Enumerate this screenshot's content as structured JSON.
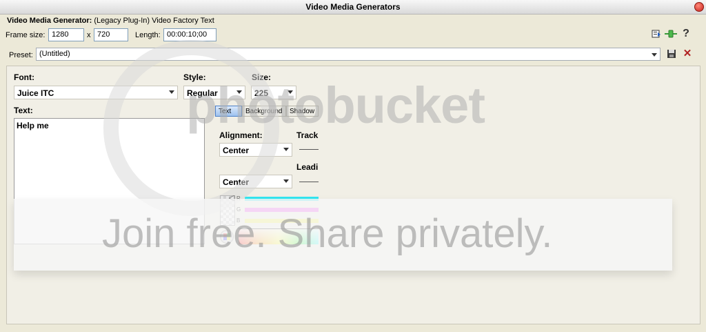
{
  "window": {
    "title": "Video Media Generators"
  },
  "header": {
    "generator_label": "Video Media Generator:",
    "generator_name": "(Legacy Plug-In) Video Factory Text",
    "frame_size_label": "Frame size:",
    "frame_width": "1280",
    "frame_x": "x",
    "frame_height": "720",
    "length_label": "Length:",
    "length_value": "00:00:10;00",
    "icons": [
      "properties-icon",
      "plugin-chain-icon",
      "help-icon"
    ]
  },
  "preset": {
    "label": "Preset:",
    "value": "(Untitled)"
  },
  "font": {
    "label": "Font:",
    "value": "Juice ITC"
  },
  "style": {
    "label": "Style:",
    "value": "Regular"
  },
  "size": {
    "label": "Size:",
    "value": "225"
  },
  "text": {
    "label": "Text:",
    "value": "Help me"
  },
  "tabs": [
    {
      "label": "Text",
      "active": true
    },
    {
      "label": "Background",
      "active": false
    },
    {
      "label": "Shadow",
      "active": false
    }
  ],
  "alignment": {
    "label": "Alignment:",
    "value": "Center"
  },
  "tracking": {
    "label": "Track"
  },
  "leading": {
    "label": "Leadi"
  },
  "vertical_alignment": {
    "value": "Center"
  },
  "color": {
    "channels": [
      "R",
      "G",
      "B"
    ],
    "colors": {
      "r": "#33e6f0",
      "g": "#ee55ee",
      "b": "#f5f55a"
    }
  },
  "watermark": {
    "brand": "photobucket",
    "slogan": "Join free. Share privately."
  }
}
